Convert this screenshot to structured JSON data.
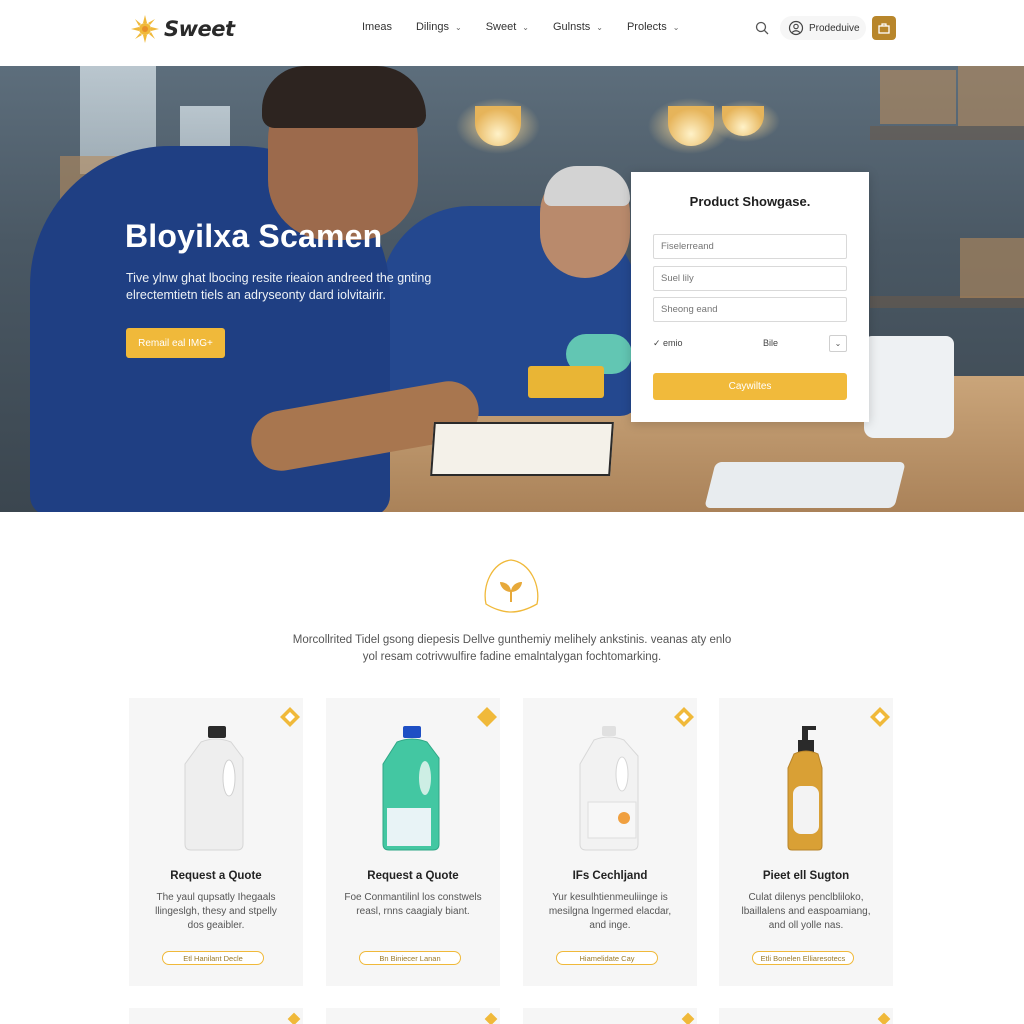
{
  "header": {
    "logo_text": "Sweet",
    "nav": [
      {
        "label": "Imeas",
        "has_dropdown": false
      },
      {
        "label": "Dilings",
        "has_dropdown": true
      },
      {
        "label": "Sweet",
        "has_dropdown": true
      },
      {
        "label": "Gulnsts",
        "has_dropdown": true
      },
      {
        "label": "Prolects",
        "has_dropdown": true
      }
    ],
    "account_label": "Prodeduive"
  },
  "hero": {
    "title": "Bloyilxa Scamen",
    "subtitle": "Tive ylnw ghat lbocing resite rieaion andreed the gnting elrectemtietn tiels an adryseonty dard iolvitairir.",
    "button_label": "Remail eal IMG+"
  },
  "form": {
    "title": "Product Showgase.",
    "fields": [
      {
        "placeholder": "Fiselerreand"
      },
      {
        "placeholder": "Suel lily"
      },
      {
        "placeholder": "Sheong eand"
      }
    ],
    "checkbox_label": "emio",
    "select_label": "Bile",
    "submit_label": "Caywiltes"
  },
  "intro": {
    "text": "Morcollrited Tidel gsong diepesis Dellve gunthemiy melihely ankstinis. veanas aty enlo yol resam cotrivwulfire fadine emalntalygan fochtomarking."
  },
  "products": [
    {
      "title": "Request a Quote",
      "description": "The yaul qupsatly Ihegaals llingeslgh, thesy and stpelly dos geaibler.",
      "button_label": "Etl Hanilant Decle",
      "bottle": "white-jug"
    },
    {
      "title": "Request a Quote",
      "description": "Foe Conmantilinl los constwels reasl, rnns caagialy biant.",
      "button_label": "Bn Biniecer Lanan",
      "bottle": "green-jug"
    },
    {
      "title": "IFs Cechljand",
      "description": "Yur kesulhtienmeuliinge is mesilgna lngermed elacdar, and inge.",
      "button_label": "Hiamelidate Cay",
      "bottle": "white-tall-jug"
    },
    {
      "title": "Pieet ell Sugton",
      "description": "Culat dilenys penclbliloko, lbaillalens and easpoamiang, and oll yolle nas.",
      "button_label": "Etli Bonelen Elliaresotecs",
      "bottle": "amber-pump"
    }
  ],
  "colors": {
    "accent": "#f0b93a",
    "accent_dark": "#b8862b",
    "card_bg": "#f6f6f6",
    "hero_shirt": "#1f3f83"
  },
  "icons": [
    "logo-sun-icon",
    "search-icon",
    "user-icon",
    "cart-icon",
    "leaf-badge-icon",
    "corner-diamond-icon"
  ]
}
